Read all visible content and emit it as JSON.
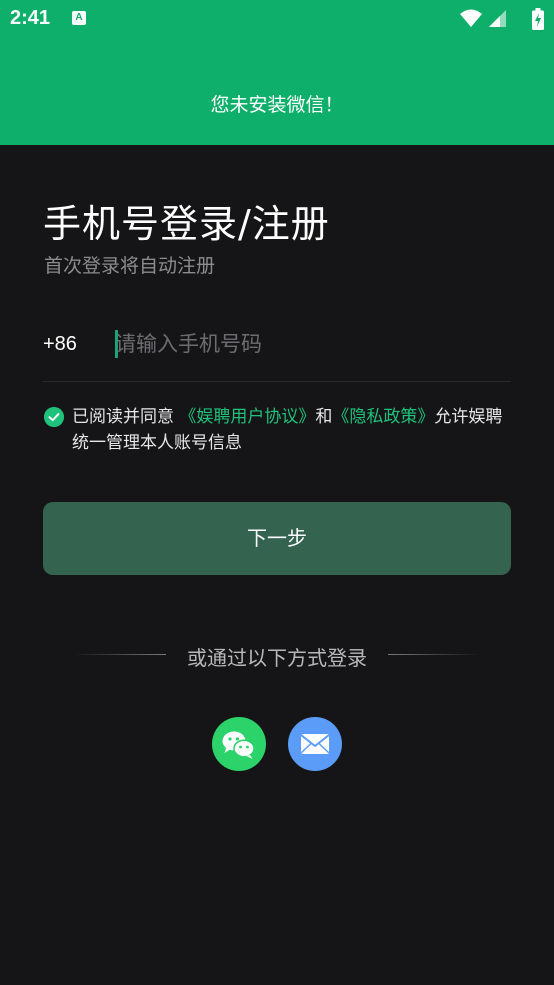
{
  "status_bar": {
    "time": "2:41",
    "app_icon_glyph": "A",
    "icons": [
      "wifi-icon",
      "signal-icon",
      "battery-charging-icon"
    ]
  },
  "toast": {
    "message": "您未安装微信！"
  },
  "login": {
    "title": "手机号登录/注册",
    "subtitle": "首次登录将自动注册",
    "country_code": "+86",
    "phone_placeholder": "请输入手机号码",
    "phone_value": "",
    "agreement": {
      "prefix": "已阅读并同意 ",
      "user_agreement": "《娱聘用户协议》",
      "and": "和",
      "privacy_policy": "《隐私政策》",
      "suffix": "允许娱聘统一管理本人账号信息",
      "checked": true
    },
    "next_button": "下一步",
    "other_methods": "或通过以下方式登录"
  },
  "colors": {
    "brand_green": "#0eaf6a",
    "link_green": "#1ec27a",
    "button_green": "#346450",
    "background": "#151517",
    "wechat": "#2bd36a",
    "mail": "#5a9cf7"
  }
}
